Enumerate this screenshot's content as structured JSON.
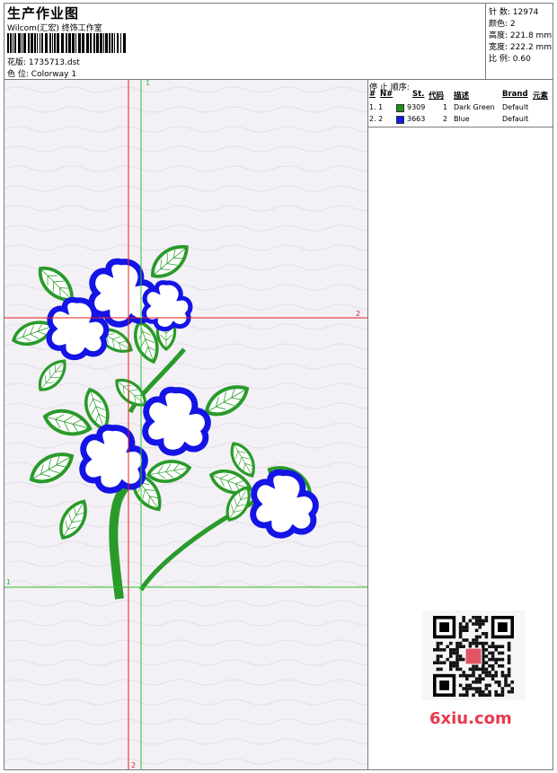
{
  "header": {
    "title": "生产作业图",
    "company": "Wilcom(汇宏) 终饰工作室",
    "design_label": "花版:",
    "design_value": "1735713.dst",
    "colorway_label": "色 位:",
    "colorway_value": "Colorway 1"
  },
  "stats": {
    "stitches_label": "针 数:",
    "stitches_value": "12974",
    "colors_label": "颜色:",
    "colors_value": "2",
    "height_label": "高度:",
    "height_value": "221.8 mm",
    "width_label": "宽度:",
    "width_value": "222.2 mm",
    "scale_label": "比 例:",
    "scale_value": "0.60"
  },
  "stop_sequence": {
    "label": "停 止 顺序:",
    "headers": {
      "hash": "#",
      "no": "N#",
      "st": "St.",
      "code": "代码",
      "desc": "描述",
      "brand": "Brand",
      "element": "元素"
    },
    "rows": [
      {
        "idx": "1. 1",
        "code_num": "9309",
        "st": "1",
        "desc": "Dark Green",
        "brand": "Default",
        "color": "#1e8c1e"
      },
      {
        "idx": "2. 2",
        "code_num": "3663",
        "st": "2",
        "desc": "Blue",
        "brand": "Default",
        "color": "#1a1ae6"
      }
    ]
  },
  "guides": {
    "v1": "1",
    "v2": "2",
    "h1": "1",
    "h2": "2"
  },
  "colors": {
    "green": "#2a9a2a",
    "blue": "#1414e6",
    "guide_red": "#e02020",
    "guide_green": "#30c030"
  },
  "watermark": "6xiu.com"
}
